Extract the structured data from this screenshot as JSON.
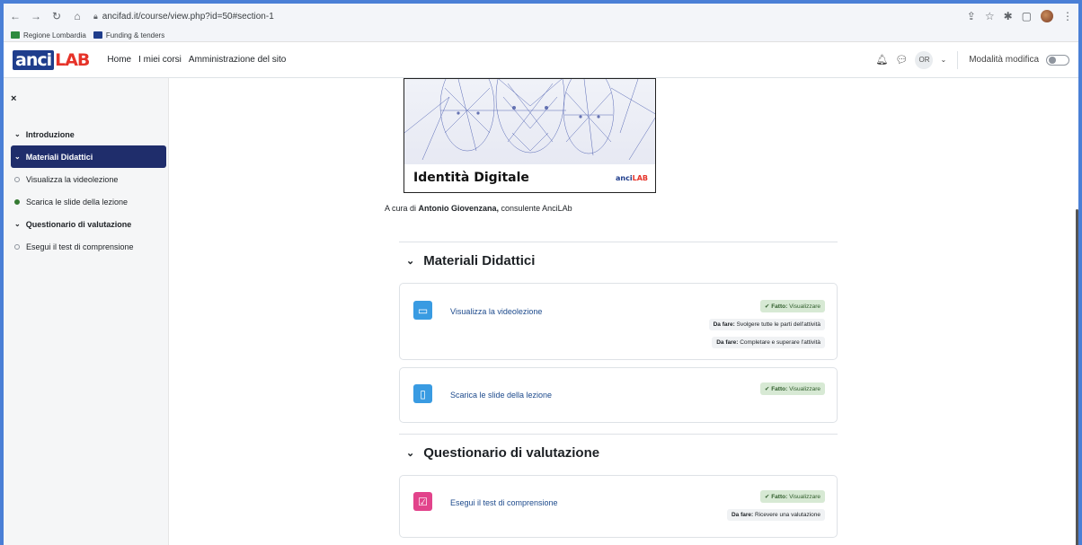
{
  "browser": {
    "url": "ancifad.it/course/view.php?id=50#section-1",
    "bookmarks": [
      "Regione Lombardia",
      "Funding & tenders"
    ]
  },
  "navbar": {
    "logo_part_a": "anci",
    "logo_part_b": "LAB",
    "links": [
      "Home",
      "I miei corsi",
      "Amministrazione del sito"
    ],
    "user_initials": "OR",
    "edit_mode_label": "Modalità modifica"
  },
  "drawer": {
    "close_label": "×",
    "items": [
      {
        "label": "Introduzione"
      },
      {
        "label": "Materiali Didattici"
      },
      {
        "label": "Visualizza la videolezione"
      },
      {
        "label": "Scarica le slide della lezione"
      },
      {
        "label": "Questionario di valutazione"
      },
      {
        "label": "Esegui il test di comprensione"
      }
    ]
  },
  "intro": {
    "cover_title": "Identità Digitale",
    "cover_logo_a": "anci",
    "cover_logo_b": "LAB",
    "byline_prefix": "A cura di ",
    "byline_author": "Antonio Giovenzana,",
    "byline_suffix": " consulente AnciLAb"
  },
  "sections": [
    {
      "title": "Materiali Didattici",
      "activities": [
        {
          "name": "Visualizza la videolezione",
          "badges": [
            {
              "label": "Fatto:",
              "text": "Visualizzare"
            },
            {
              "label": "Da fare:",
              "text": "Svolgere tutte le parti dell'attività"
            },
            {
              "label": "Da fare:",
              "text": "Completare e superare l'attività"
            }
          ]
        },
        {
          "name": "Scarica le slide della lezione",
          "badges": [
            {
              "label": "Fatto:",
              "text": "Visualizzare"
            }
          ]
        }
      ]
    },
    {
      "title": "Questionario di valutazione",
      "activities": [
        {
          "name": "Esegui il test di comprensione",
          "badges": [
            {
              "label": "Fatto:",
              "text": "Visualizzare"
            },
            {
              "label": "Da fare:",
              "text": "Ricevere una valutazione"
            }
          ]
        }
      ]
    }
  ],
  "colors": {
    "accent": "#1f2d6b",
    "done_badge": "#d7e9d4",
    "todo_badge": "#f0f2f4",
    "link": "#1d4a8c",
    "resource_icon": "#399be2",
    "quiz_icon": "#e2438b"
  }
}
